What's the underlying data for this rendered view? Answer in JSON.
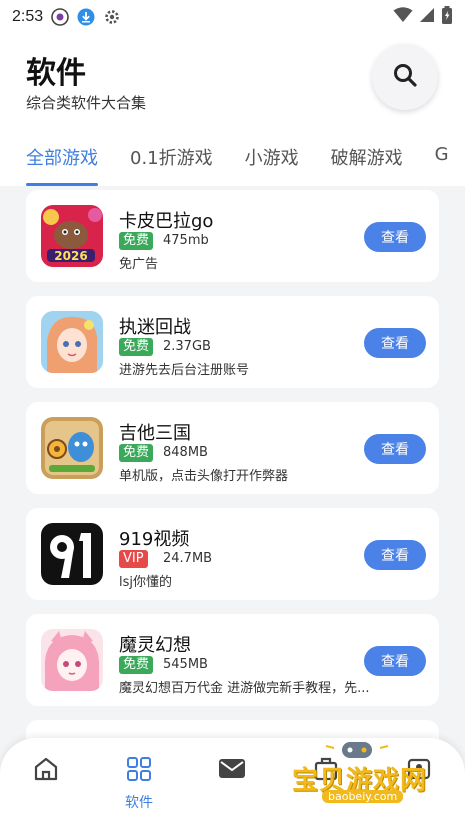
{
  "status_bar": {
    "time": "2:53"
  },
  "header": {
    "title": "软件",
    "subtitle": "综合类软件大合集"
  },
  "tabs": [
    {
      "label": "全部游戏",
      "active": true
    },
    {
      "label": "0.1折游戏",
      "active": false
    },
    {
      "label": "小游戏",
      "active": false
    },
    {
      "label": "破解游戏",
      "active": false
    },
    {
      "label": "G",
      "active": false
    }
  ],
  "apps": [
    {
      "name": "卡皮巴拉go",
      "badge": "免费",
      "badge_type": "free",
      "size": "475mb",
      "desc": "免广告",
      "button": "查看"
    },
    {
      "name": "执迷回战",
      "badge": "免费",
      "badge_type": "free",
      "size": "2.37GB",
      "desc": "进游先去后台注册账号",
      "button": "查看"
    },
    {
      "name": "吉他三国",
      "badge": "免费",
      "badge_type": "free",
      "size": "848MB",
      "desc": "单机版，点击头像打开作弊器",
      "button": "查看"
    },
    {
      "name": "919视频",
      "badge": "VIP",
      "badge_type": "vip",
      "size": "24.7MB",
      "desc": "lsj你懂的",
      "button": "查看"
    },
    {
      "name": "魔灵幻想",
      "badge": "免费",
      "badge_type": "free",
      "size": "545MB",
      "desc": "魔灵幻想百万代金 进游做完新手教程，先...",
      "button": "查看"
    }
  ],
  "bottom_nav": {
    "active_label": "软件"
  },
  "watermark": {
    "text": "宝贝游戏网",
    "url": "baobeiy.com"
  },
  "colors": {
    "accent": "#3f7fe0",
    "button": "#4a82e8",
    "free": "#3aaa5a",
    "vip": "#e74848"
  }
}
